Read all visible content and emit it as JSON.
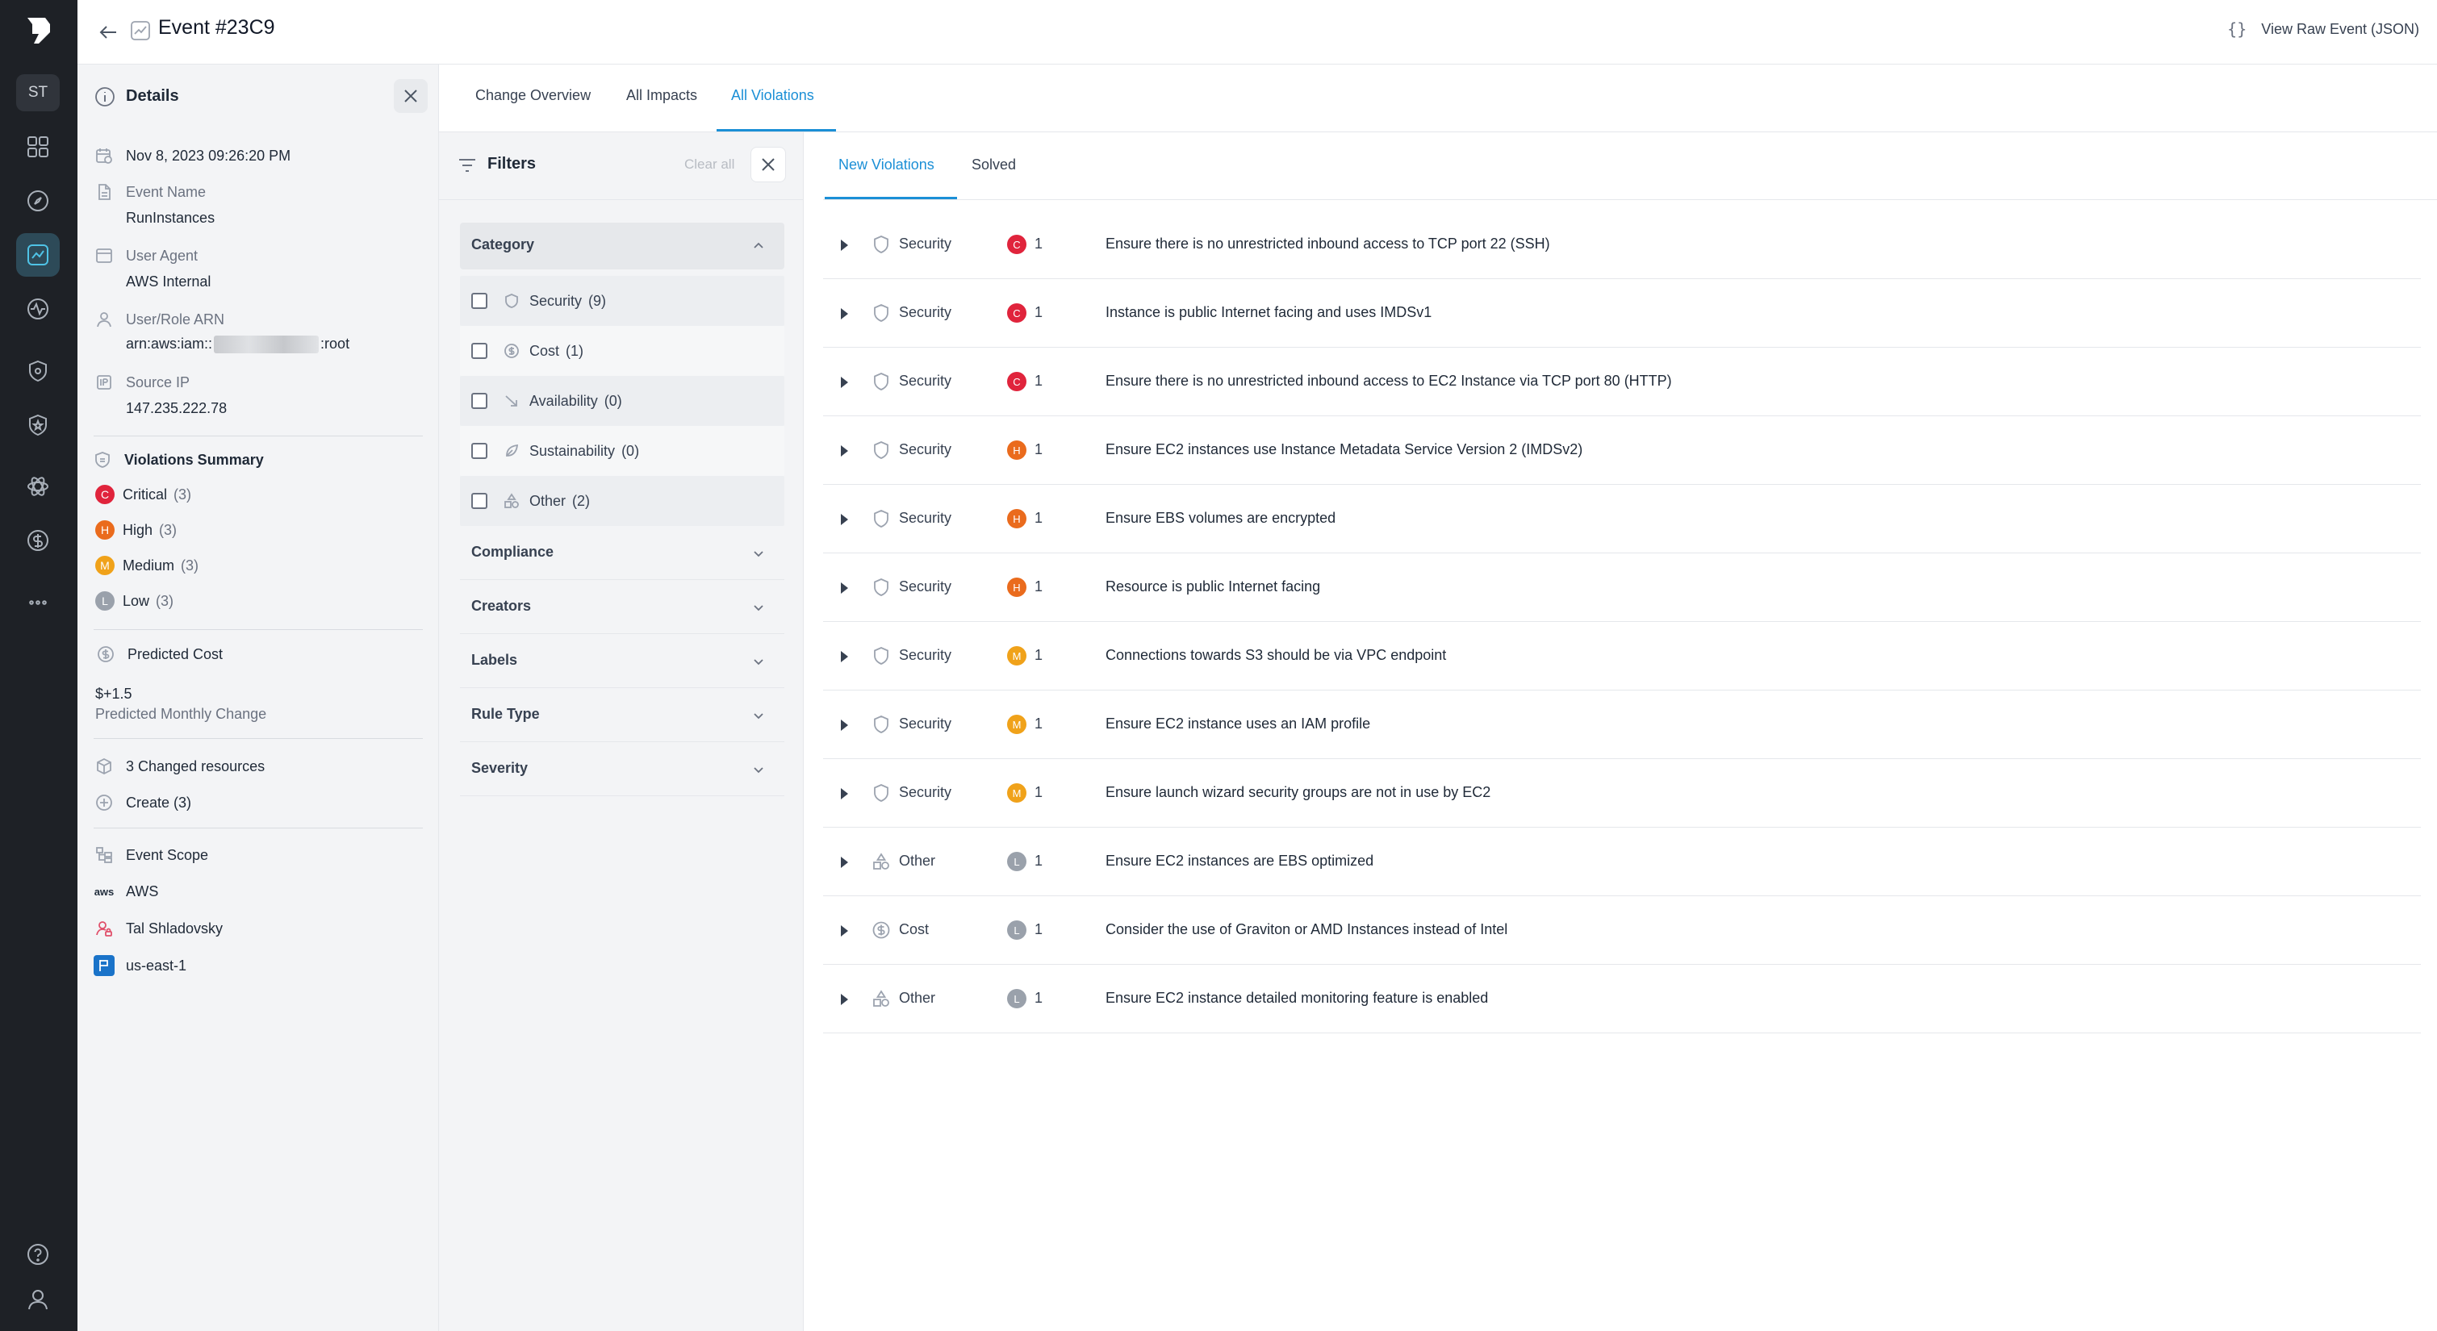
{
  "header": {
    "title": "Event #23C9",
    "raw_label": "View Raw Event (JSON)",
    "raw_icon": "{}"
  },
  "rail": {
    "avatar": "ST"
  },
  "details": {
    "title": "Details",
    "timestamp": "Nov 8, 2023 09:26:20 PM",
    "event_name_label": "Event Name",
    "event_name": "RunInstances",
    "user_agent_label": "User Agent",
    "user_agent": "AWS Internal",
    "arn_label": "User/Role ARN",
    "arn_prefix": "arn:aws:iam::",
    "arn_suffix": ":root",
    "source_ip_label": "Source IP",
    "source_ip": "147.235.222.78",
    "violations_summary_label": "Violations Summary",
    "severities": [
      {
        "letter": "C",
        "label": "Critical",
        "count": "(3)",
        "color": "#e0243c"
      },
      {
        "letter": "H",
        "label": "High",
        "count": "(3)",
        "color": "#ea6b1d"
      },
      {
        "letter": "M",
        "label": "Medium",
        "count": "(3)",
        "color": "#f0a21a"
      },
      {
        "letter": "L",
        "label": "Low",
        "count": "(3)",
        "color": "#9aa1ab"
      }
    ],
    "predicted_cost_label": "Predicted Cost",
    "predicted_cost_value": "$+1.5",
    "predicted_cost_sub": "Predicted Monthly Change",
    "changed_resources": "3 Changed resources",
    "create_label": "Create (3)",
    "event_scope_label": "Event Scope",
    "scope_provider_icon": "aws",
    "scope_provider": "AWS",
    "scope_user": "Tal Shladovsky",
    "scope_region": "us-east-1"
  },
  "tabs": [
    "Change Overview",
    "All Impacts",
    "All Violations"
  ],
  "filters": {
    "title": "Filters",
    "clear_all": "Clear all",
    "category_label": "Category",
    "categories": [
      {
        "label": "Security",
        "count": "(9)",
        "icon": "shield-icon"
      },
      {
        "label": "Cost",
        "count": "(1)",
        "icon": "dollar-icon"
      },
      {
        "label": "Availability",
        "count": "(0)",
        "icon": "trend-down-icon"
      },
      {
        "label": "Sustainability",
        "count": "(0)",
        "icon": "leaf-icon"
      },
      {
        "label": "Other",
        "count": "(2)",
        "icon": "shapes-icon"
      }
    ],
    "facets": [
      "Compliance",
      "Creators",
      "Labels",
      "Rule Type",
      "Severity"
    ]
  },
  "subtabs": [
    "New Violations",
    "Solved"
  ],
  "violations": [
    {
      "category": "Security",
      "sev": "C",
      "count": "1",
      "text": "Ensure there is no unrestricted inbound access to TCP port 22 (SSH)"
    },
    {
      "category": "Security",
      "sev": "C",
      "count": "1",
      "text": "Instance is public Internet facing and uses IMDSv1"
    },
    {
      "category": "Security",
      "sev": "C",
      "count": "1",
      "text": "Ensure there is no unrestricted inbound access to EC2 Instance via TCP port 80 (HTTP)"
    },
    {
      "category": "Security",
      "sev": "H",
      "count": "1",
      "text": "Ensure EC2 instances use Instance Metadata Service Version 2 (IMDSv2)"
    },
    {
      "category": "Security",
      "sev": "H",
      "count": "1",
      "text": "Ensure EBS volumes are encrypted"
    },
    {
      "category": "Security",
      "sev": "H",
      "count": "1",
      "text": "Resource is public Internet facing"
    },
    {
      "category": "Security",
      "sev": "M",
      "count": "1",
      "text": "Connections towards S3 should be via VPC endpoint"
    },
    {
      "category": "Security",
      "sev": "M",
      "count": "1",
      "text": "Ensure EC2 instance uses an IAM profile"
    },
    {
      "category": "Security",
      "sev": "M",
      "count": "1",
      "text": "Ensure launch wizard security groups are not in use by EC2"
    },
    {
      "category": "Other",
      "sev": "L",
      "count": "1",
      "text": "Ensure EC2 instances are EBS optimized"
    },
    {
      "category": "Cost",
      "sev": "L",
      "count": "1",
      "text": "Consider the use of Graviton or AMD Instances instead of Intel"
    },
    {
      "category": "Other",
      "sev": "L",
      "count": "1",
      "text": "Ensure EC2 instance detailed monitoring feature is enabled"
    }
  ],
  "colors": {
    "accent": "#1b8fd6",
    "critical": "#e0243c",
    "high": "#ea6b1d",
    "medium": "#f0a21a",
    "low": "#9aa1ab"
  }
}
